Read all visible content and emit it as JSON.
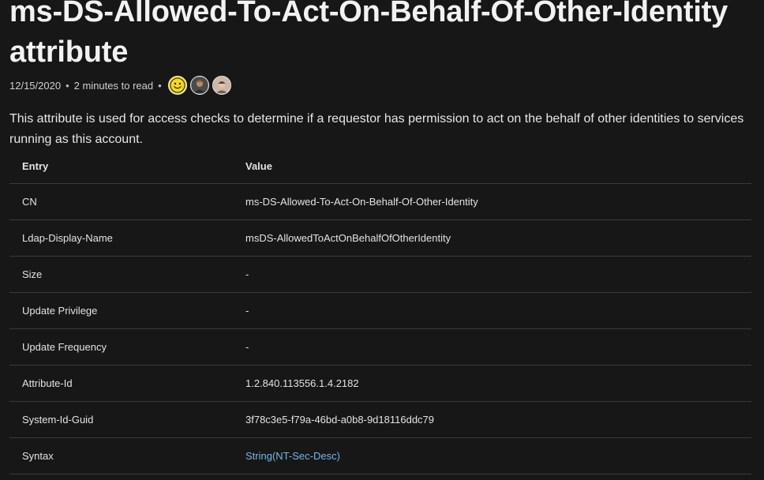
{
  "article": {
    "title": "ms-DS-Allowed-To-Act-On-Behalf-Of-Other-Identity attribute",
    "date": "12/15/2020",
    "separator": "•",
    "read_time": "2 minutes to read",
    "contributors": [
      "smiley-avatar",
      "contributor-avatar",
      "contributor-avatar"
    ],
    "intro": "This attribute is used for access checks to determine if a requestor has permission to act on the behalf of other identities to services running as this account."
  },
  "table": {
    "headers": [
      "Entry",
      "Value"
    ],
    "rows": [
      {
        "entry": "CN",
        "value": "ms-DS-Allowed-To-Act-On-Behalf-Of-Other-Identity"
      },
      {
        "entry": "Ldap-Display-Name",
        "value": "msDS-AllowedToActOnBehalfOfOtherIdentity"
      },
      {
        "entry": "Size",
        "value": "-"
      },
      {
        "entry": "Update Privilege",
        "value": "-"
      },
      {
        "entry": "Update Frequency",
        "value": "-"
      },
      {
        "entry": "Attribute-Id",
        "value": "1.2.840.113556.1.4.2182"
      },
      {
        "entry": "System-Id-Guid",
        "value": "3f78c3e5-f79a-46bd-a0b8-9d18116ddc79"
      },
      {
        "entry": "Syntax",
        "value": "String(NT-Sec-Desc)"
      }
    ]
  },
  "colors": {
    "background": "#171717",
    "text": "#e6e6e6",
    "link": "#75b6e7",
    "divider": "#3a3a3a"
  }
}
